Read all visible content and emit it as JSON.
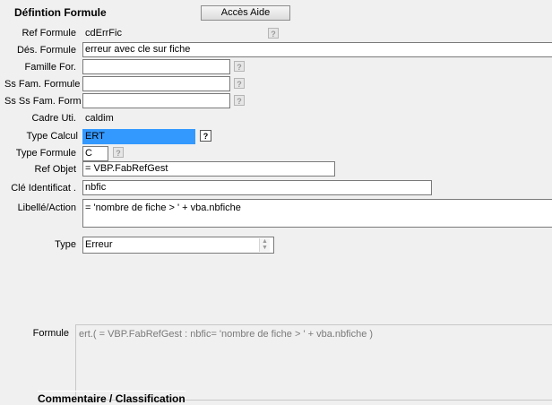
{
  "header": {
    "title": "Défintion Formule",
    "help_button": "Accès Aide"
  },
  "help_icon_text": "?",
  "fields": {
    "ref_formule": {
      "label": "Ref Formule",
      "value": "cdErrFic"
    },
    "des_formule": {
      "label": "Dés. Formule",
      "value": "erreur avec cle sur fiche"
    },
    "famille": {
      "label": "Famille For.",
      "value": ""
    },
    "ss_fam": {
      "label": "Ss Fam. Formule",
      "value": ""
    },
    "ss_ss_fam": {
      "label": "Ss Ss Fam. Form",
      "value": ""
    },
    "cadre_uti": {
      "label": "Cadre Uti.",
      "value": "caldim"
    },
    "type_calcul": {
      "label": "Type Calcul",
      "value": "ERT"
    },
    "type_formule": {
      "label": "Type Formule",
      "value": "C"
    },
    "ref_objet": {
      "label": "Ref Objet",
      "value": "= VBP.FabRefGest"
    },
    "cle_ident": {
      "label": "Clé Identificat .",
      "value": "nbfic"
    },
    "libelle": {
      "label": "Libellé/Action",
      "value": "= 'nombre de fiche > ' +  vba.nbfiche"
    },
    "type": {
      "label": "Type",
      "value": "Erreur"
    },
    "formule": {
      "label": "Formule",
      "value": "ert.( = VBP.FabRefGest : nbfic= 'nombre de fiche > ' +  vba.nbfiche )"
    }
  },
  "footer": {
    "section_title": "Commentaire / Classification"
  },
  "colors": {
    "selection": "#3399ff",
    "window_bg": "#f0f0f0"
  }
}
